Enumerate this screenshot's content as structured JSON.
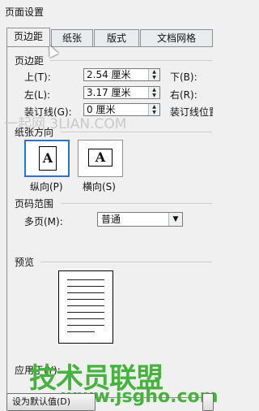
{
  "window": {
    "title": "页面设置"
  },
  "tabs": [
    {
      "label": "页边距",
      "active": true
    },
    {
      "label": "纸张",
      "active": false
    },
    {
      "label": "版式",
      "active": false
    },
    {
      "label": "文档网格",
      "active": false
    }
  ],
  "margins": {
    "group_label": "页边距",
    "top_label": "上(T):",
    "top_value": "2.54 厘米",
    "bottom_label": "下(B):",
    "left_label": "左(L):",
    "left_value": "3.17 厘米",
    "right_label": "右(R):",
    "gutter_label": "装订线(G):",
    "gutter_value": "0 厘米",
    "gutter_pos_label": "装订线位置"
  },
  "orientation": {
    "group_label": "纸张方向",
    "portrait_label": "纵向(P)",
    "landscape_label": "横向(S)",
    "icon_letter": "A",
    "selected": "portrait"
  },
  "pages": {
    "group_label": "页码范围",
    "multiple_label": "多页(M):",
    "multiple_value": "普通"
  },
  "preview": {
    "group_label": "预览"
  },
  "apply": {
    "label": "应用于(Y):"
  },
  "buttons": {
    "default_label": "设为默认值(D)"
  },
  "watermarks": {
    "site1": "一起网 3LIAN.COM",
    "site2": "技术员联盟",
    "site3": "www.jsgho.com"
  }
}
